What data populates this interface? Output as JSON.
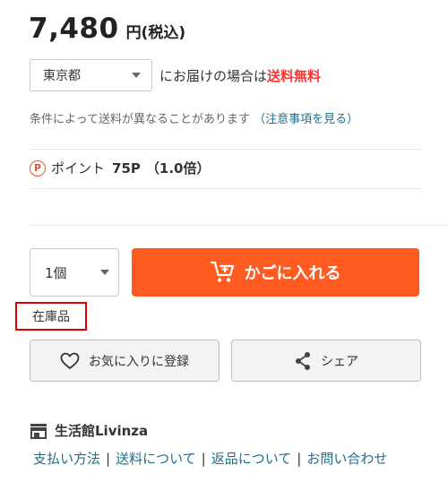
{
  "price": {
    "amount": "7,480",
    "unit": "円(税込)"
  },
  "delivery": {
    "prefecture": "東京都",
    "text": "にお届けの場合は",
    "free_label": "送料無料"
  },
  "note": {
    "text": "条件によって送料が異なることがあります",
    "link_label": "（注意事項を見る）"
  },
  "points": {
    "label": "ポイント",
    "value": "75P",
    "rate": "（1.0倍）",
    "icon_letter": "P"
  },
  "quantity": {
    "value": "1個"
  },
  "cart": {
    "label": "かごに入れる"
  },
  "stock": {
    "label": "在庫品"
  },
  "favorite": {
    "label": "お気に入りに登録"
  },
  "share": {
    "label": "シェア"
  },
  "shop": {
    "name": "生活館Livinza"
  },
  "links": {
    "payment": "支払い方法",
    "shipping": "送料について",
    "returns": "返品について",
    "contact": "お問い合わせ",
    "separator": "|"
  },
  "colors": {
    "accent": "#ff5a1f",
    "free_shipping": "#ff3333",
    "link": "#1f6f8b",
    "highlight_box": "#e00000"
  }
}
